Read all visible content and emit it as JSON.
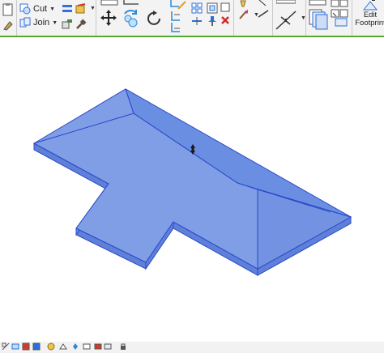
{
  "ribbon": {
    "modify_group": {
      "cut_label": "Cut",
      "join_label": "Join"
    },
    "mode_group": {
      "edit_footprint_line1": "Edit",
      "edit_footprint_line2": "Footprint"
    },
    "accent_color": "#5aa832"
  },
  "canvas": {
    "element": "roof",
    "roof_color": "#7f9ee6",
    "roof_edge_color": "#2a48c8",
    "slope_arrow": "slope-control-icon"
  },
  "statusbar": {
    "icons": [
      "scale-icon",
      "detail-level-icon",
      "visual-style-icon",
      "sun-path-icon",
      "shadows-icon",
      "render-icon",
      "crop-view-icon",
      "show-crop-icon",
      "temporary-hide-icon",
      "reveal-hidden-icon",
      "worksharing-icon",
      "lock-icon"
    ]
  }
}
